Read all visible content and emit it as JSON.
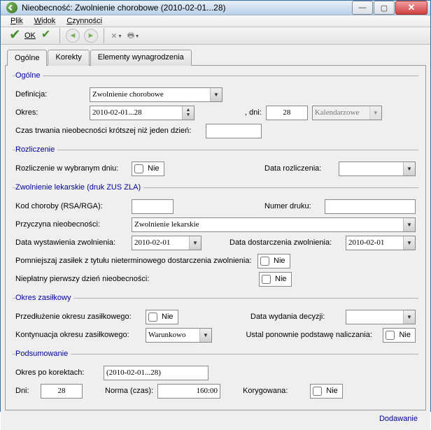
{
  "window": {
    "title": "Nieobecność: Zwolnienie chorobowe (2010-02-01...28)"
  },
  "menu": {
    "plik": "Plik",
    "widok": "Widok",
    "czynnosci": "Czynności"
  },
  "toolbar": {
    "ok": "OK"
  },
  "tabs": {
    "ogolne": "Ogólne",
    "korekty": "Korekty",
    "elementy": "Elementy wynagrodzenia"
  },
  "sec_ogolne": {
    "legend": "Ogólne",
    "definicja_label": "Definicja:",
    "definicja_value": "Zwolnienie chorobowe",
    "okres_label": "Okres:",
    "okres_value": "2010-02-01...28",
    "dni_label": ", dni:",
    "dni_value": "28",
    "kalendarzowe": "Kalendarzowe",
    "czas_label": "Czas trwania nieobecności krótszej niż jeden dzień:",
    "czas_value": ""
  },
  "sec_rozliczenie": {
    "legend": "Rozliczenie",
    "rozl_label": "Rozliczenie w wybranym dniu:",
    "rozl_value": "Nie",
    "data_label": "Data rozliczenia:",
    "data_value": ""
  },
  "sec_zwolnienie": {
    "legend": "Zwolnienie lekarskie (druk ZUS ZLA)",
    "kod_label": "Kod choroby (RSA/RGA):",
    "kod_value": "",
    "numer_label": "Numer druku:",
    "numer_value": "",
    "przyczyna_label": "Przyczyna nieobecności:",
    "przyczyna_value": "Zwolnienie lekarskie",
    "data_wyst_label": "Data wystawienia zwolnienia:",
    "data_wyst_value": "2010-02-01",
    "data_dost_label": "Data dostarczenia zwolnienia:",
    "data_dost_value": "2010-02-01",
    "pomn_label": "Pomniejszaj zasiłek z tytułu nieterminowego dostarczenia zwolnienia:",
    "pomn_value": "Nie",
    "niepl_label": "Niepłatny pierwszy dzień nieobecności:",
    "niepl_value": "Nie"
  },
  "sec_okres": {
    "legend": "Okres zasiłkowy",
    "przedl_label": "Przedłużenie okresu zasiłkowego:",
    "przedl_value": "Nie",
    "data_dec_label": "Data wydania decyzji:",
    "data_dec_value": "",
    "kont_label": "Kontynuacja okresu zasiłkowego:",
    "kont_value": "Warunkowo",
    "ustal_label": "Ustal ponownie podstawę naliczania:",
    "ustal_value": "Nie"
  },
  "sec_pods": {
    "legend": "Podsumowanie",
    "okres_label": "Okres po korektach:",
    "okres_value": "(2010-02-01...28)",
    "dni_label": "Dni:",
    "dni_value": "28",
    "norma_label": "Norma (czas):",
    "norma_value": "160:00",
    "koryg_label": "Korygowana:",
    "koryg_value": "Nie"
  },
  "footer": "Dodawanie"
}
